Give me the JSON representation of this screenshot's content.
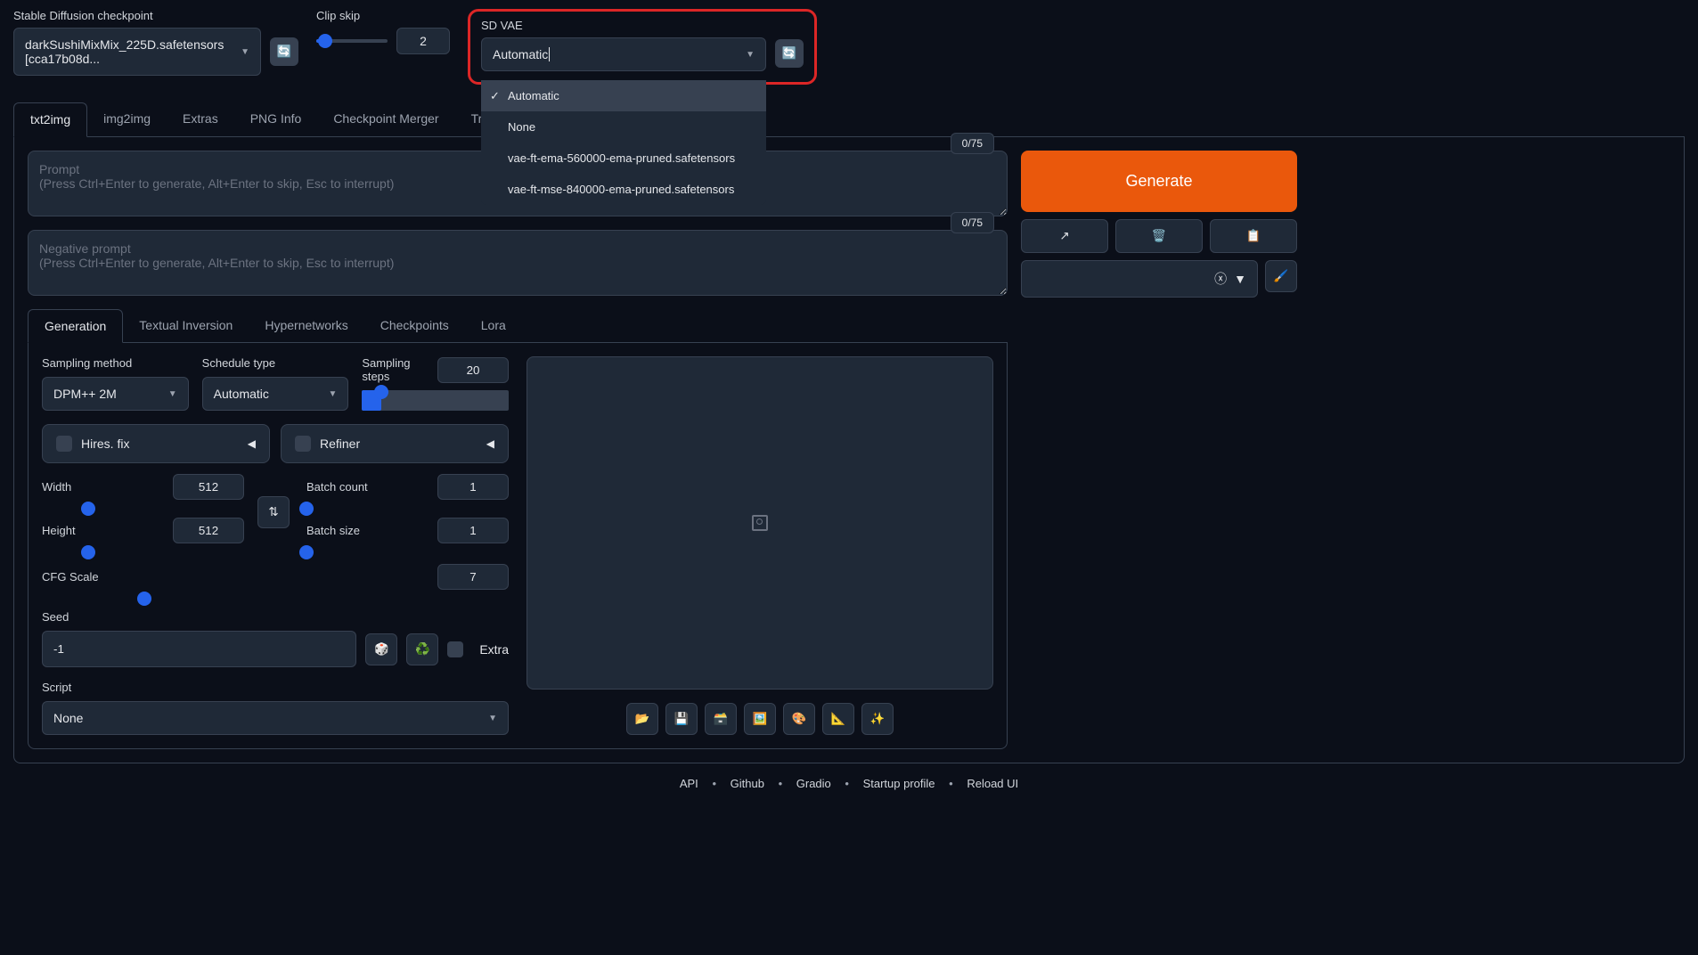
{
  "top": {
    "checkpoint_label": "Stable Diffusion checkpoint",
    "checkpoint_value": "darkSushiMixMix_225D.safetensors [cca17b08d...",
    "clip_skip_label": "Clip skip",
    "clip_skip_value": "2",
    "sd_vae_label": "SD VAE",
    "sd_vae_value": "Automatic",
    "vae_options": [
      "Automatic",
      "None",
      "vae-ft-ema-560000-ema-pruned.safetensors",
      "vae-ft-mse-840000-ema-pruned.safetensors"
    ]
  },
  "tabs": [
    "txt2img",
    "img2img",
    "Extras",
    "PNG Info",
    "Checkpoint Merger",
    "Train"
  ],
  "prompt": {
    "placeholder": "Prompt\n(Press Ctrl+Enter to generate, Alt+Enter to skip, Esc to interrupt)",
    "counter": "0/75"
  },
  "neg_prompt": {
    "placeholder": "Negative prompt\n(Press Ctrl+Enter to generate, Alt+Enter to skip, Esc to interrupt)",
    "counter": "0/75"
  },
  "generate_label": "Generate",
  "sub_tabs": [
    "Generation",
    "Textual Inversion",
    "Hypernetworks",
    "Checkpoints",
    "Lora"
  ],
  "gen": {
    "sampling_method_label": "Sampling method",
    "sampling_method_value": "DPM++ 2M",
    "schedule_label": "Schedule type",
    "schedule_value": "Automatic",
    "sampling_steps_label": "Sampling steps",
    "sampling_steps_value": "20",
    "hires_label": "Hires. fix",
    "refiner_label": "Refiner",
    "width_label": "Width",
    "width_value": "512",
    "height_label": "Height",
    "height_value": "512",
    "batch_count_label": "Batch count",
    "batch_count_value": "1",
    "batch_size_label": "Batch size",
    "batch_size_value": "1",
    "cfg_label": "CFG Scale",
    "cfg_value": "7",
    "seed_label": "Seed",
    "seed_value": "-1",
    "extra_label": "Extra",
    "script_label": "Script",
    "script_value": "None"
  },
  "output_icons": [
    "📂",
    "💾",
    "🗃️",
    "🖼️",
    "🎨",
    "📐",
    "✨"
  ],
  "footer": {
    "links": [
      "API",
      "Github",
      "Gradio",
      "Startup profile",
      "Reload UI"
    ]
  }
}
